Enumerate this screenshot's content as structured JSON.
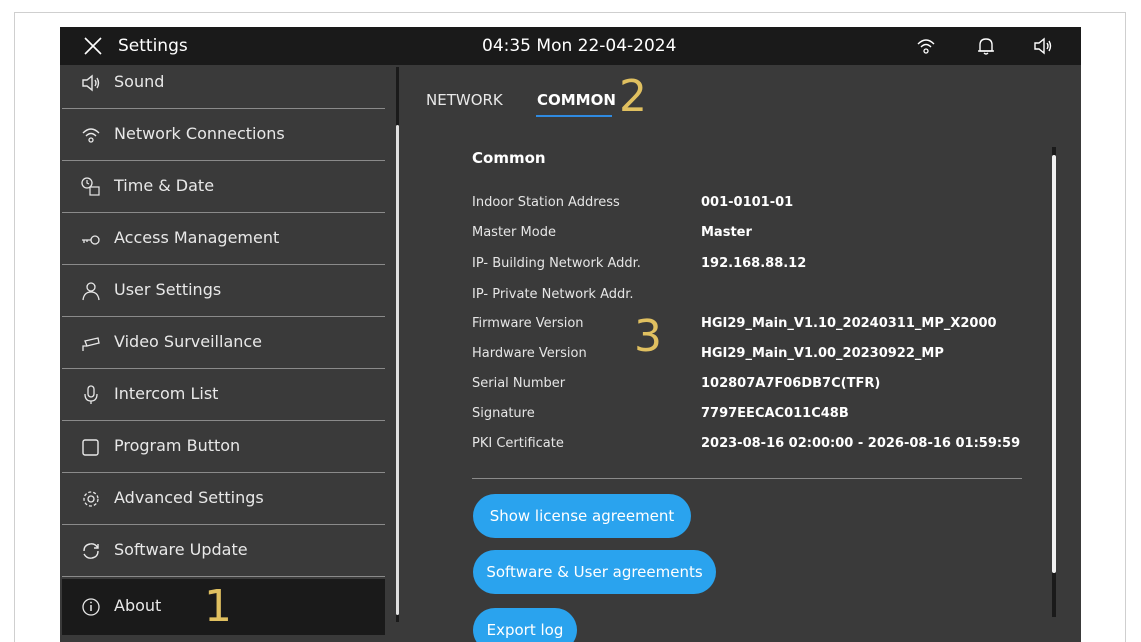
{
  "topbar": {
    "title": "Settings",
    "datetime": "04:35  Mon 22-04-2024",
    "icons": [
      "close-icon",
      "wifi-icon",
      "bell-icon",
      "speaker-icon"
    ]
  },
  "sidebar": {
    "items": [
      {
        "label": "Sound",
        "icon": "speaker-icon"
      },
      {
        "label": "Network Connections",
        "icon": "wifi-icon"
      },
      {
        "label": "Time & Date",
        "icon": "calendar-clock-icon"
      },
      {
        "label": "Access Management",
        "icon": "key-icon"
      },
      {
        "label": "User Settings",
        "icon": "user-icon"
      },
      {
        "label": "Video Surveillance",
        "icon": "camera-icon"
      },
      {
        "label": "Intercom List",
        "icon": "microphone-icon"
      },
      {
        "label": "Program Button",
        "icon": "square-icon"
      },
      {
        "label": "Advanced Settings",
        "icon": "gear-icon"
      },
      {
        "label": "Software Update",
        "icon": "refresh-icon"
      },
      {
        "label": "About",
        "icon": "info-icon",
        "active": true
      }
    ]
  },
  "tabs": [
    {
      "label": "NETWORK"
    },
    {
      "label": "COMMON",
      "active": true
    }
  ],
  "annotations": {
    "one": "1",
    "two": "2",
    "three": "3"
  },
  "common": {
    "title": "Common",
    "rows": [
      {
        "label": "Indoor Station Address",
        "value": "001-0101-01"
      },
      {
        "label": "Master Mode",
        "value": "Master"
      },
      {
        "label": "IP- Building Network Addr.",
        "value": "192.168.88.12"
      },
      {
        "label": "IP- Private Network Addr.",
        "value": ""
      },
      {
        "label": "Firmware Version",
        "value": "HGI29_Main_V1.10_20240311_MP_X2000"
      },
      {
        "label": "Hardware Version",
        "value": "HGI29_Main_V1.00_20230922_MP"
      },
      {
        "label": "Serial Number",
        "value": "102807A7F06DB7C(TFR)"
      },
      {
        "label": "Signature",
        "value": "7797EECAC011C48B"
      },
      {
        "label": "PKI Certificate",
        "value": "2023-08-16 02:00:00 - 2026-08-16 01:59:59"
      }
    ]
  },
  "buttons": {
    "license": "Show license agreement",
    "agreements": "Software & User agreements",
    "export": "Export log"
  },
  "colors": {
    "accent": "#2aa3ee",
    "annotation": "#e0c060",
    "background": "#3a3a3a",
    "bar": "#1a1a1a"
  }
}
